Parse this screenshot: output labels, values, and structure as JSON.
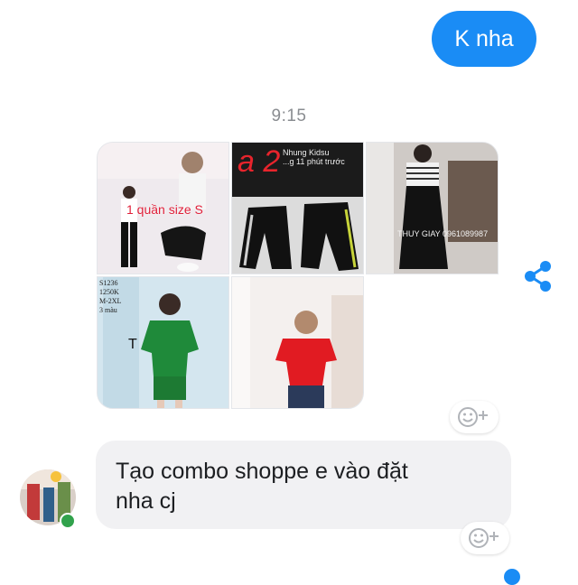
{
  "sent_message": {
    "text": "K nha"
  },
  "timestamp": "9:15",
  "photos": [
    {
      "label": "1 quần size S",
      "icon": "photo-woman-black-pants-icon"
    },
    {
      "label": "Nhung Kidsu\n...g 11 phút trước",
      "overlay": "a 2",
      "icon": "photo-black-track-pants-icon"
    },
    {
      "label": "THUY GIAY 0961089987",
      "icon": "photo-striped-dress-icon"
    },
    {
      "label": "S1236\n1250K\nM-2XL\n3 màu",
      "icon": "photo-green-set-icon"
    },
    {
      "label": "",
      "icon": "photo-red-polo-icon"
    }
  ],
  "received_message": {
    "text_line1": "Tạo combo shoppe e vào đặt",
    "text_line2": "nha cj"
  },
  "icons": {
    "share": "share-icon",
    "react": "add-reaction-icon",
    "avatar": "avatar"
  },
  "colors": {
    "sent_bubble": "#1a8cf5",
    "received_bubble": "#f1f1f3",
    "share": "#1a8cf5",
    "online": "#31a24c"
  }
}
